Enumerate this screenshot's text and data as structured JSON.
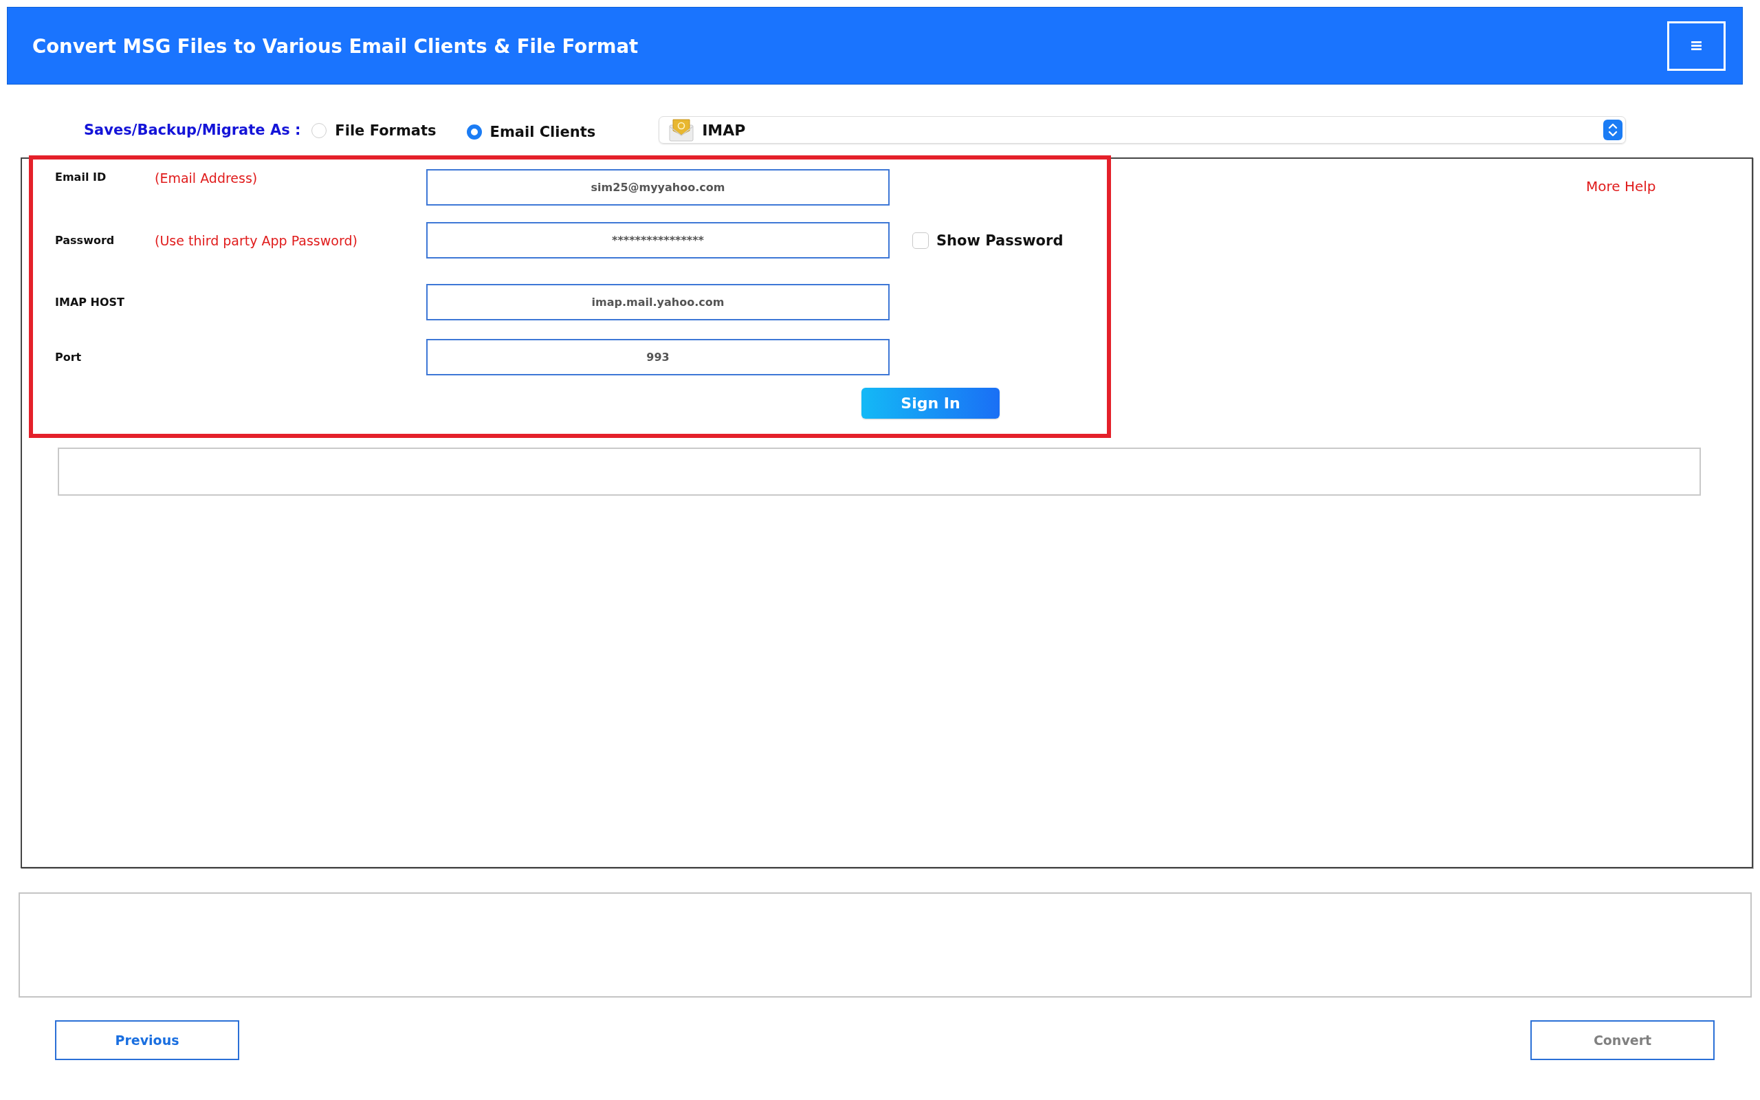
{
  "header": {
    "title": "Convert MSG Files to Various Email Clients & File Format"
  },
  "save_as": {
    "label": "Saves/Backup/Migrate As :",
    "options": [
      {
        "label": "File Formats",
        "selected": false
      },
      {
        "label": "Email Clients",
        "selected": true
      }
    ],
    "dropdown": {
      "value": "IMAP"
    }
  },
  "login_form": {
    "fields": [
      {
        "label": "Email ID",
        "hint": "(Email Address)",
        "value": "sim25@myyahoo.com"
      },
      {
        "label": "Password",
        "hint": "(Use third party App Password)",
        "value": "****************",
        "show_password": {
          "label": "Show Password",
          "checked": false
        }
      },
      {
        "label": "IMAP HOST",
        "value": "imap.mail.yahoo.com"
      },
      {
        "label": "Port",
        "value": "993"
      }
    ],
    "sign_in_button": "Sign In"
  },
  "more_help": "More Help",
  "buttons": [
    {
      "label": "Previous",
      "disabled": false
    },
    {
      "label": "Convert",
      "disabled": true
    }
  ]
}
